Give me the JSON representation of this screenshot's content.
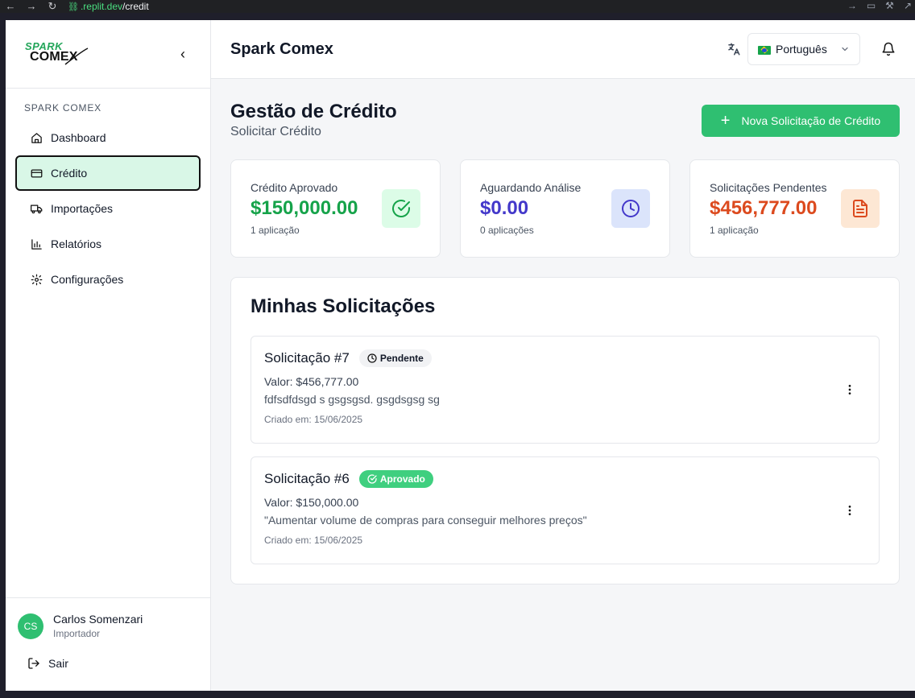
{
  "browser": {
    "url_host": ".replit.dev",
    "url_path": "/credit"
  },
  "sidebar": {
    "logo_top": "SPARK",
    "logo_bottom": "COMEX",
    "section": "SPARK COMEX",
    "items": [
      {
        "label": "Dashboard",
        "icon": "home-icon"
      },
      {
        "label": "Crédito",
        "icon": "credit-card-icon"
      },
      {
        "label": "Importações",
        "icon": "truck-icon"
      },
      {
        "label": "Relatórios",
        "icon": "bar-chart-icon"
      },
      {
        "label": "Configurações",
        "icon": "gear-icon"
      }
    ],
    "user": {
      "initials": "CS",
      "name": "Carlos Somenzari",
      "role": "Importador"
    },
    "logout": "Sair"
  },
  "header": {
    "title": "Spark Comex",
    "language": "Português"
  },
  "page": {
    "title": "Gestão de Crédito",
    "subtitle": "Solicitar Crédito",
    "new_button": "Nova Solicitação de Crédito"
  },
  "stats": [
    {
      "label": "Crédito Aprovado",
      "value": "$150,000.00",
      "count": "1 aplicação",
      "color": "#16a34a",
      "icon_bg": "#dcfce7"
    },
    {
      "label": "Aguardando Análise",
      "value": "$0.00",
      "count": "0 aplicações",
      "color": "#4338ca",
      "icon_bg": "#dbe4fb"
    },
    {
      "label": "Solicitações Pendentes",
      "value": "$456,777.00",
      "count": "1 aplicação",
      "color": "#dc4a1e",
      "icon_bg": "#fde7d4"
    }
  ],
  "requests": {
    "title": "Minhas Solicitações",
    "items": [
      {
        "name": "Solicitação #7",
        "status": "Pendente",
        "value": "Valor: $456,777.00",
        "desc": "fdfsdfdsgd s gsgsgsd. gsgdsgsg sg",
        "date": "Criado em: 15/06/2025"
      },
      {
        "name": "Solicitação #6",
        "status": "Aprovado",
        "value": "Valor: $150,000.00",
        "desc": "\"Aumentar volume de compras para conseguir melhores preços\"",
        "date": "Criado em: 15/06/2025"
      }
    ]
  },
  "colors": {
    "accent": "#2fbf71",
    "active_bg": "#d9f7e7"
  }
}
